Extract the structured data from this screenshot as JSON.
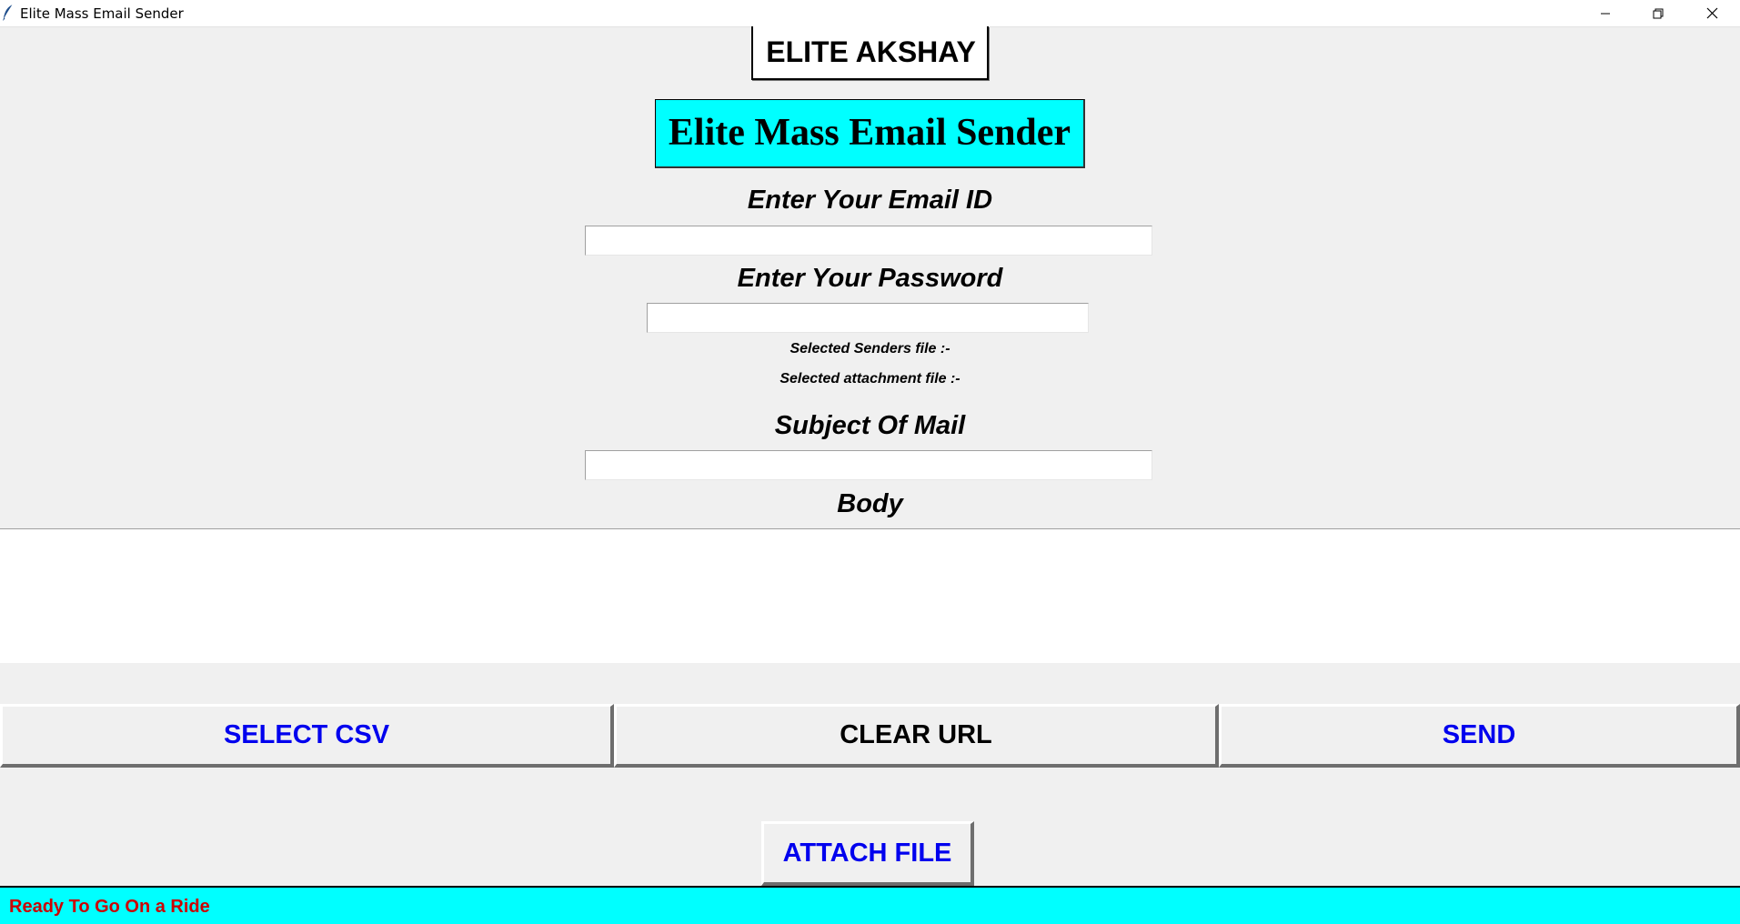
{
  "window": {
    "title": "Elite Mass Email Sender",
    "icon": "feather-icon",
    "controls": [
      "minimize-icon",
      "restore-icon",
      "close-icon"
    ]
  },
  "header": {
    "brand": "ELITE AKSHAY",
    "app_title": "Elite Mass Email Sender"
  },
  "form": {
    "email_label": "Enter Your Email ID",
    "email_value": "",
    "password_label": "Enter Your Password",
    "password_value": "",
    "senders_file_label": "Selected Senders file :-",
    "attachment_file_label": "Selected attachment file :-",
    "subject_label": "Subject Of Mail",
    "subject_value": "",
    "body_label": "Body",
    "body_value": ""
  },
  "buttons": {
    "select_csv": "SELECT CSV",
    "clear_url": "CLEAR URL",
    "send": "SEND",
    "attach_file": "ATTACH FILE"
  },
  "status": {
    "text": "Ready To Go On a Ride"
  },
  "colors": {
    "accent_cyan": "#00ffff",
    "button_blue": "#0000ee",
    "status_red": "#cc0000",
    "background": "#f0f0f0"
  }
}
